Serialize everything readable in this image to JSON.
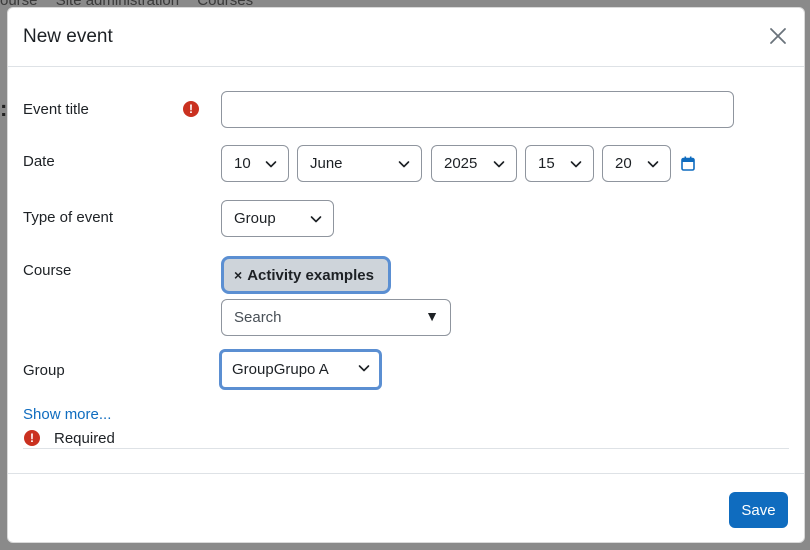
{
  "background": {
    "breadcrumb": [
      "ourse",
      "Site administration",
      "Courses"
    ]
  },
  "modal": {
    "title": "New event",
    "close_icon": "close-icon"
  },
  "form": {
    "event_title": {
      "label": "Event title",
      "value": "",
      "required_icon": "exclamation-circle-icon"
    },
    "date": {
      "label": "Date",
      "day": "10",
      "month": "June",
      "year": "2025",
      "hour": "15",
      "minute": "20",
      "calendar_icon": "calendar-icon"
    },
    "type_of_event": {
      "label": "Type of event",
      "value": "Group"
    },
    "course": {
      "label": "Course",
      "selected_chip": "Activity examples",
      "chip_remove": "×",
      "search_placeholder": "Search",
      "dropdown_arrow": "▼"
    },
    "group": {
      "label": "Group",
      "value": "GroupGrupo A"
    },
    "show_more": "Show more...",
    "required_note": "Required"
  },
  "footer": {
    "save_label": "Save"
  },
  "colors": {
    "primary": "#0f6cbf",
    "required": "#ca3120",
    "focus": "#5b8fd2"
  }
}
